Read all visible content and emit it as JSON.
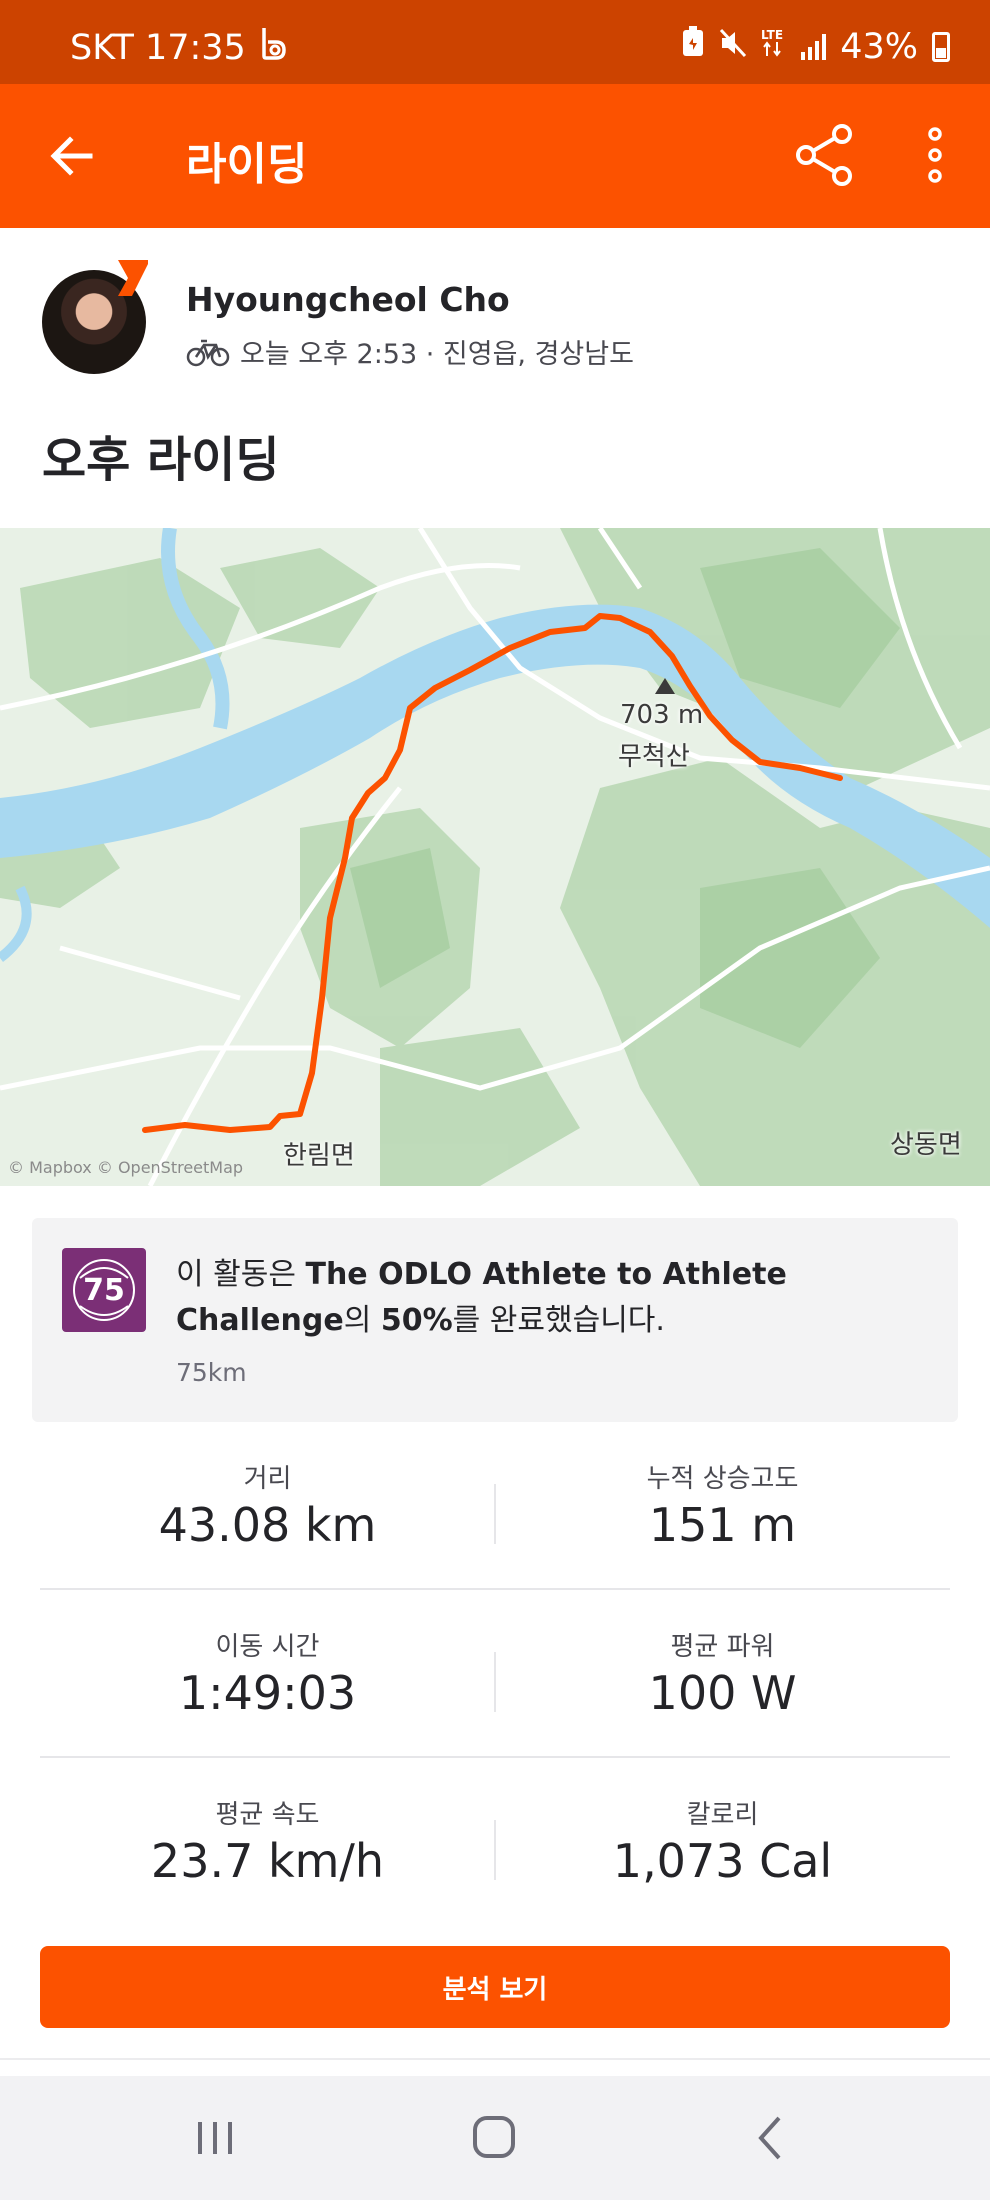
{
  "status_bar": {
    "carrier_time": "SKT 17:35",
    "battery": "43%",
    "network": "LTE",
    "icons": [
      "b-app-icon",
      "battery-saver-icon",
      "mute-icon",
      "lte-icon",
      "signal-icon",
      "battery-icon"
    ]
  },
  "app_bar": {
    "title": "라이딩",
    "icons": [
      "arrow-left-icon",
      "share-icon",
      "more-vertical-icon"
    ]
  },
  "athlete": {
    "name": "Hyoungcheol Cho",
    "meta": "오늘 오후 2:53 · 진영읍, 경상남도",
    "activity_title": "오후 라이딩"
  },
  "map": {
    "labels": {
      "peak_elevation": "703 m",
      "peak_name": "무척산",
      "town_1": "한림면",
      "town_2": "상동면"
    },
    "attribution": "© Mapbox © OpenStreetMap",
    "colors": {
      "route": "#fc5200",
      "water": "#a8d8f0",
      "land": "#e8f1e6",
      "forest": "#b7d7b2"
    }
  },
  "challenge": {
    "text_prefix": "이 활동은 ",
    "text_bold_1": "The ODLO Athlete to Athlete Challenge",
    "text_mid": "의 ",
    "text_bold_2": "50%",
    "text_suffix": "를 완료했습니다.",
    "distance": "75km",
    "badge_colors": {
      "bg": "#7b2f76"
    }
  },
  "stats": [
    {
      "left_label": "거리",
      "left_value": "43.08 km",
      "right_label": "누적 상승고도",
      "right_value": "151 m"
    },
    {
      "left_label": "이동 시간",
      "left_value": "1:49:03",
      "right_label": "평균 파워",
      "right_value": "100 W"
    },
    {
      "left_label": "평균 속도",
      "left_value": "23.7 km/h",
      "right_label": "칼로리",
      "right_value": "1,073 Cal"
    }
  ],
  "analysis_button": "분석 보기",
  "nav_bar": {
    "icons": [
      "recent-apps-icon",
      "home-icon",
      "back-icon"
    ]
  },
  "colors": {
    "accent": "#fc5200",
    "status_bar": "#cc4300"
  }
}
